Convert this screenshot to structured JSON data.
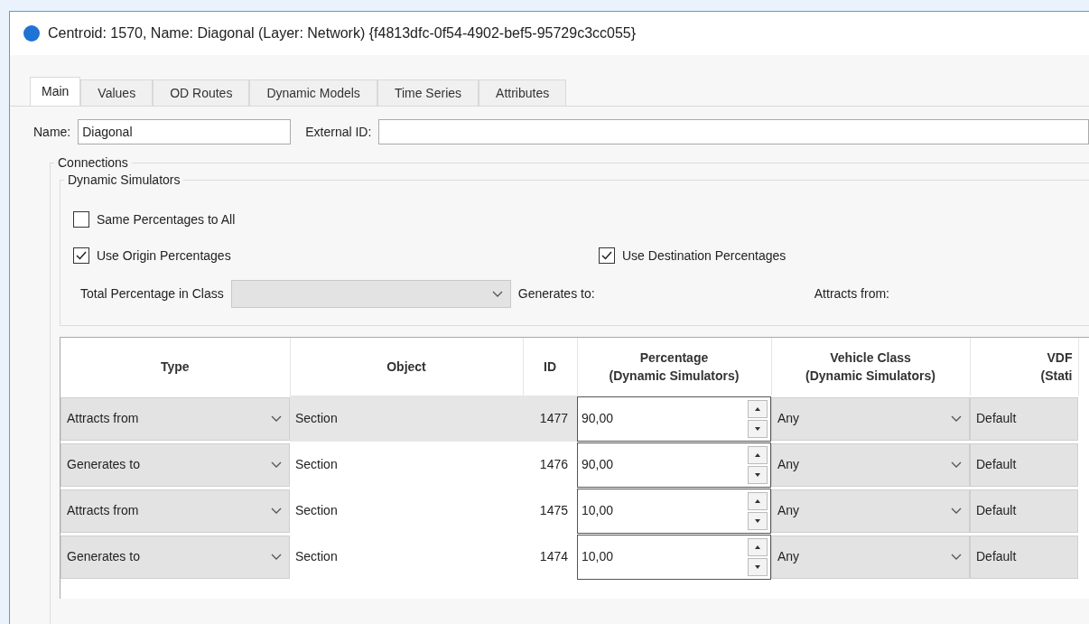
{
  "window": {
    "title": "Centroid: 1570, Name: Diagonal (Layer: Network) {f4813dfc-0f54-4902-bef5-95729c3cc055}"
  },
  "tabs": [
    {
      "label": "Main",
      "selected": true
    },
    {
      "label": "Values",
      "selected": false
    },
    {
      "label": "OD Routes",
      "selected": false
    },
    {
      "label": "Dynamic Models",
      "selected": false
    },
    {
      "label": "Time Series",
      "selected": false
    },
    {
      "label": "Attributes",
      "selected": false
    }
  ],
  "name_field": {
    "label": "Name:",
    "value": "Diagonal"
  },
  "external_id_field": {
    "label": "External ID:"
  },
  "connections": {
    "title": "Connections",
    "dynamic_simulators": {
      "title": "Dynamic Simulators",
      "same_percentages": {
        "label": "Same Percentages to All",
        "checked": false
      },
      "use_origin": {
        "label": "Use Origin Percentages",
        "checked": true
      },
      "use_destination": {
        "label": "Use Destination Percentages",
        "checked": true
      },
      "total_percentage_label": "Total Percentage in Class",
      "generates_to_label": "Generates to:",
      "attracts_from_label": "Attracts from:"
    },
    "table": {
      "columns": [
        "Type",
        "Object",
        "ID",
        "Percentage\n(Dynamic Simulators)",
        "Vehicle Class\n(Dynamic Simulators)",
        "VDF\n(Stati"
      ],
      "rows": [
        {
          "type": "Attracts from",
          "object": "Section",
          "id": "1477",
          "percentage": "90,00",
          "vehicle_class": "Any",
          "vdf": "Default",
          "selected": true
        },
        {
          "type": "Generates to",
          "object": "Section",
          "id": "1476",
          "percentage": "90,00",
          "vehicle_class": "Any",
          "vdf": "Default",
          "selected": false
        },
        {
          "type": "Attracts from",
          "object": "Section",
          "id": "1475",
          "percentage": "10,00",
          "vehicle_class": "Any",
          "vdf": "Default",
          "selected": false
        },
        {
          "type": "Generates to",
          "object": "Section",
          "id": "1474",
          "percentage": "10,00",
          "vehicle_class": "Any",
          "vdf": "Default",
          "selected": false
        }
      ]
    }
  }
}
